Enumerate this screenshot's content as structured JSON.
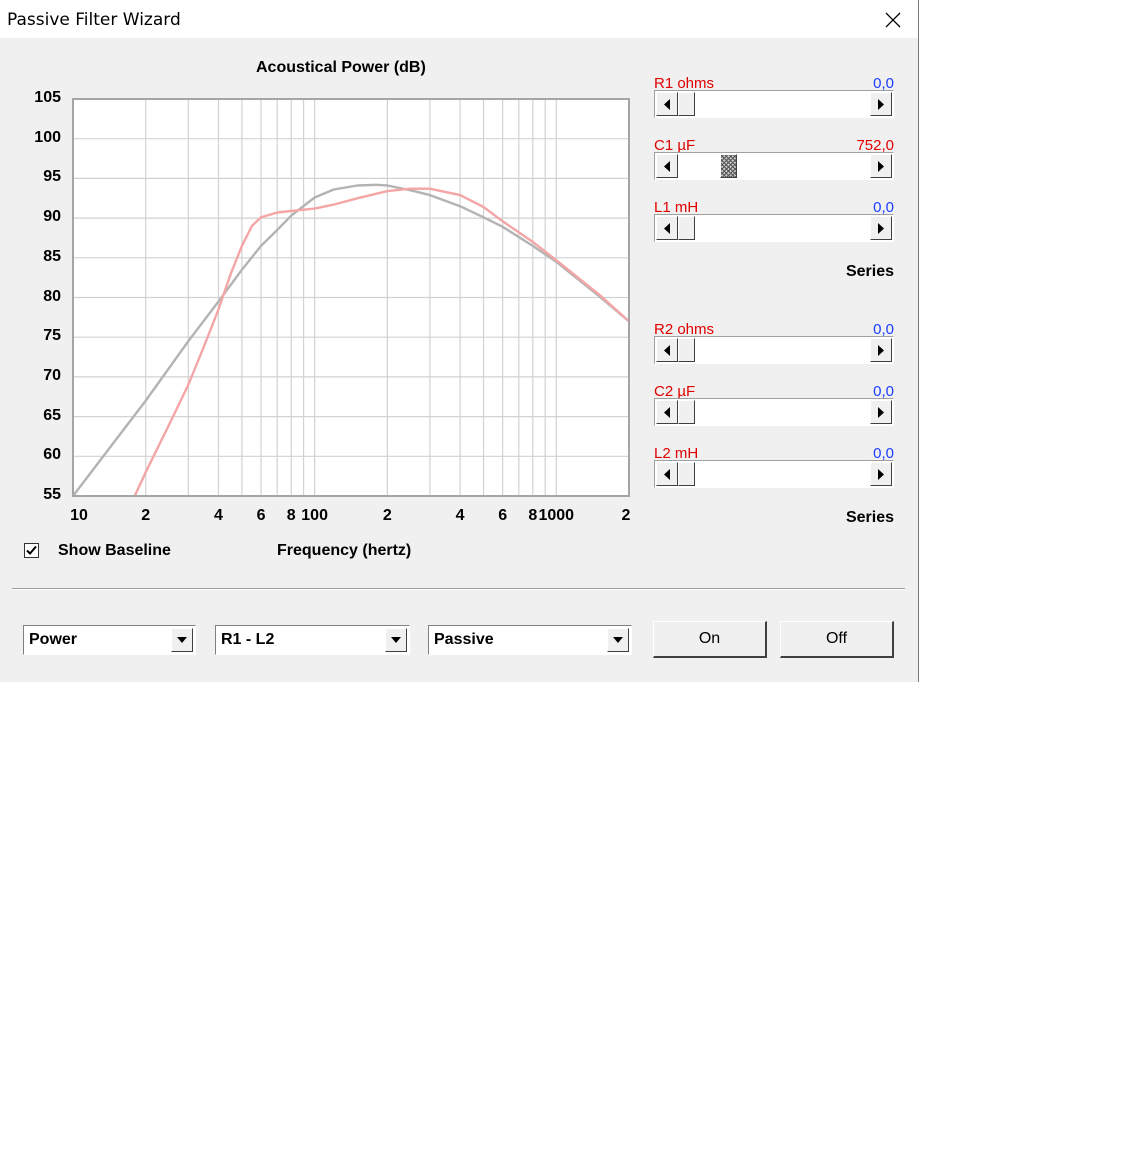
{
  "window": {
    "title": "Passive Filter Wizard"
  },
  "chart_data": {
    "type": "line",
    "title": "Acoustical Power (dB)",
    "xlabel": "Frequency (hertz)",
    "ylabel": "",
    "xscale": "log",
    "xlim": [
      10,
      2000
    ],
    "ylim": [
      55,
      105
    ],
    "yticks": [
      "105",
      "100",
      "95",
      "90",
      "85",
      "80",
      "75",
      "70",
      "65",
      "60",
      "55"
    ],
    "xticks": [
      {
        "v": 10,
        "label": "10"
      },
      {
        "v": 20,
        "label": "2"
      },
      {
        "v": 40,
        "label": "4"
      },
      {
        "v": 60,
        "label": "6"
      },
      {
        "v": 80,
        "label": "8"
      },
      {
        "v": 100,
        "label": "100"
      },
      {
        "v": 200,
        "label": "2"
      },
      {
        "v": 400,
        "label": "4"
      },
      {
        "v": 600,
        "label": "6"
      },
      {
        "v": 800,
        "label": "8"
      },
      {
        "v": 1000,
        "label": "1000"
      },
      {
        "v": 2000,
        "label": "2"
      }
    ],
    "grid": true,
    "series": [
      {
        "color": "#b3b3b3",
        "x": [
          10,
          20,
          30,
          40,
          50,
          60,
          70,
          80,
          100,
          120,
          150,
          180,
          200,
          250,
          300,
          400,
          500,
          600,
          800,
          1000,
          1500,
          2000
        ],
        "y": [
          55,
          67,
          74.5,
          79.5,
          83.5,
          86.5,
          88.5,
          90.3,
          92.6,
          93.6,
          94.1,
          94.2,
          94.1,
          93.5,
          92.9,
          91.5,
          90.1,
          88.9,
          86.5,
          84.5,
          80.2,
          77
        ]
      },
      {
        "color": "#f4a6a6",
        "x": [
          18,
          20,
          25,
          30,
          35,
          40,
          45,
          50,
          55,
          60,
          70,
          80,
          100,
          120,
          150,
          200,
          250,
          300,
          400,
          500,
          600,
          800,
          1000,
          1500,
          2000
        ],
        "y": [
          55,
          58,
          64,
          69,
          74,
          78.5,
          83,
          86.5,
          89,
          90.1,
          90.7,
          90.9,
          91.2,
          91.7,
          92.5,
          93.4,
          93.7,
          93.7,
          92.9,
          91.4,
          89.6,
          87,
          84.7,
          80.4,
          77
        ]
      }
    ]
  },
  "show_baseline": {
    "label": "Show Baseline",
    "checked": true
  },
  "controls_group1": {
    "items": [
      {
        "label": "R1  ohms",
        "value": "0,0",
        "value_color": "#1a3cff",
        "thumb": 0.0,
        "active": false
      },
      {
        "label": "C1  µF",
        "value": "752,0",
        "value_color": "#e00000",
        "thumb": 0.24,
        "active": true
      },
      {
        "label": "L1  mH",
        "value": "0,0",
        "value_color": "#1a3cff",
        "thumb": 0.0,
        "active": false
      }
    ],
    "mode": "Series"
  },
  "controls_group2": {
    "items": [
      {
        "label": "R2  ohms",
        "value": "0,0",
        "value_color": "#1a3cff",
        "thumb": 0.0,
        "active": false
      },
      {
        "label": "C2  µF",
        "value": "0,0",
        "value_color": "#1a3cff",
        "thumb": 0.0,
        "active": false
      },
      {
        "label": "L2  mH",
        "value": "0,0",
        "value_color": "#1a3cff",
        "thumb": 0.0,
        "active": false
      }
    ],
    "mode": "Series"
  },
  "bottom": {
    "combo_type": "Power",
    "combo_range": "R1 - L2",
    "combo_kind": "Passive",
    "on_label": "On",
    "off_label": "Off"
  }
}
